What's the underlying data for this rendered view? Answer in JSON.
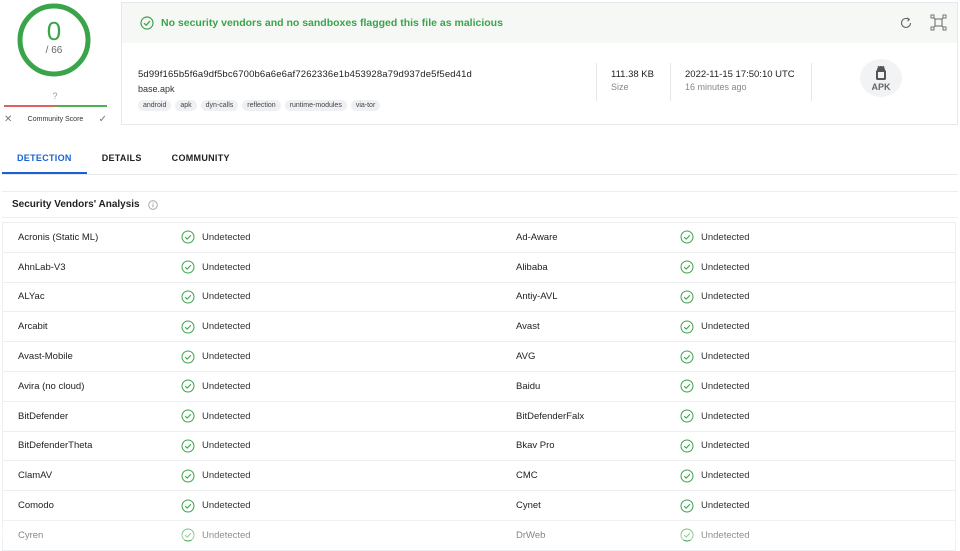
{
  "score": {
    "detections": "0",
    "total": "/ 66",
    "community_value": "?",
    "community_label": "Community Score",
    "colors": {
      "ring": "#3aa44a",
      "bad": "#e06060",
      "good": "#4caf50"
    }
  },
  "banner": {
    "text": "No security vendors and no sandboxes flagged this file as malicious",
    "icon": "check-circle-icon",
    "color": "#3aa44a"
  },
  "file": {
    "hash": "5d99f165b5f6a9df5bc6700b6a6e6af7262336e1b453928a79d937de5f5ed41d",
    "name": "base.apk",
    "tags": [
      "android",
      "apk",
      "dyn-calls",
      "reflection",
      "runtime-modules",
      "via-tor"
    ],
    "size_value": "111.38 KB",
    "size_label": "Size",
    "date_value": "2022-11-15 17:50:10 UTC",
    "date_relative": "16 minutes ago",
    "type_badge": "APK"
  },
  "tabs": [
    {
      "label": "DETECTION",
      "active": true
    },
    {
      "label": "DETAILS",
      "active": false
    },
    {
      "label": "COMMUNITY",
      "active": false
    }
  ],
  "section": {
    "title": "Security Vendors' Analysis"
  },
  "accent": "#1a62d2",
  "rows": [
    {
      "vendor_left": "Acronis (Static ML)",
      "result_left": "Undetected",
      "vendor_right": "Ad-Aware",
      "result_right": "Undetected"
    },
    {
      "vendor_left": "AhnLab-V3",
      "result_left": "Undetected",
      "vendor_right": "Alibaba",
      "result_right": "Undetected"
    },
    {
      "vendor_left": "ALYac",
      "result_left": "Undetected",
      "vendor_right": "Antiy-AVL",
      "result_right": "Undetected"
    },
    {
      "vendor_left": "Arcabit",
      "result_left": "Undetected",
      "vendor_right": "Avast",
      "result_right": "Undetected"
    },
    {
      "vendor_left": "Avast-Mobile",
      "result_left": "Undetected",
      "vendor_right": "AVG",
      "result_right": "Undetected"
    },
    {
      "vendor_left": "Avira (no cloud)",
      "result_left": "Undetected",
      "vendor_right": "Baidu",
      "result_right": "Undetected"
    },
    {
      "vendor_left": "BitDefender",
      "result_left": "Undetected",
      "vendor_right": "BitDefenderFalx",
      "result_right": "Undetected"
    },
    {
      "vendor_left": "BitDefenderTheta",
      "result_left": "Undetected",
      "vendor_right": "Bkav Pro",
      "result_right": "Undetected"
    },
    {
      "vendor_left": "ClamAV",
      "result_left": "Undetected",
      "vendor_right": "CMC",
      "result_right": "Undetected"
    },
    {
      "vendor_left": "Comodo",
      "result_left": "Undetected",
      "vendor_right": "Cynet",
      "result_right": "Undetected"
    },
    {
      "vendor_left": "Cyren",
      "result_left": "Undetected",
      "vendor_right": "DrWeb",
      "result_right": "Undetected"
    }
  ]
}
